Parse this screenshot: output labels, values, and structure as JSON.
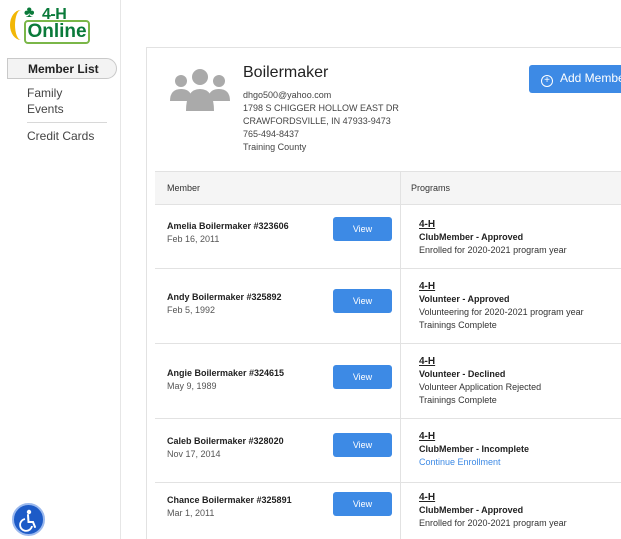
{
  "brand": {
    "line1": "4-H",
    "line2": "Online"
  },
  "sidebar": {
    "active": "Member List",
    "group1": [
      "Family",
      "Events"
    ],
    "group2": [
      "Credit Cards"
    ]
  },
  "family": {
    "name": "Boilermaker",
    "email": "dhgo500@yahoo.com",
    "address1": "1798 S CHIGGER HOLLOW EAST DR",
    "address2": "CRAWFORDSVILLE, IN 47933-9473",
    "phone": "765-494-8437",
    "county": "Training County"
  },
  "add_button": {
    "label": "Add Member"
  },
  "table": {
    "col_member": "Member",
    "col_programs": "Programs",
    "view_label": "View",
    "rows": [
      {
        "name": "Amelia Boilermaker #323606",
        "date": "Feb 16, 2011",
        "program": "4-H",
        "role": "ClubMember - Approved",
        "line1": "Enrolled for 2020-2021 program year",
        "line2": ""
      },
      {
        "name": "Andy Boilermaker #325892",
        "date": "Feb 5, 1992",
        "program": "4-H",
        "role": "Volunteer - Approved",
        "line1": "Volunteering for 2020-2021 program year",
        "line2": "Trainings Complete"
      },
      {
        "name": "Angie Boilermaker #324615",
        "date": "May 9, 1989",
        "program": "4-H",
        "role": "Volunteer - Declined",
        "line1": "Volunteer Application Rejected",
        "line2": "Trainings Complete"
      },
      {
        "name": "Caleb Boilermaker #328020",
        "date": "Nov 17, 2014",
        "program": "4-H",
        "role": "ClubMember - Incomplete",
        "line1": "Continue Enrollment",
        "line2": ""
      },
      {
        "name": "Chance Boilermaker #325891",
        "date": "Mar 1, 2011",
        "program": "4-H",
        "role": "ClubMember - Approved",
        "line1": "Enrolled for 2020-2021 program year",
        "line2": ""
      }
    ]
  },
  "colors": {
    "accent": "#3d8ae5",
    "brand_green": "#0a7a3a",
    "brand_yellow": "#f2b705"
  },
  "icons": {
    "avatar": "family-avatar-icon",
    "add": "plus-circle-icon",
    "accessibility": "accessibility-icon"
  }
}
